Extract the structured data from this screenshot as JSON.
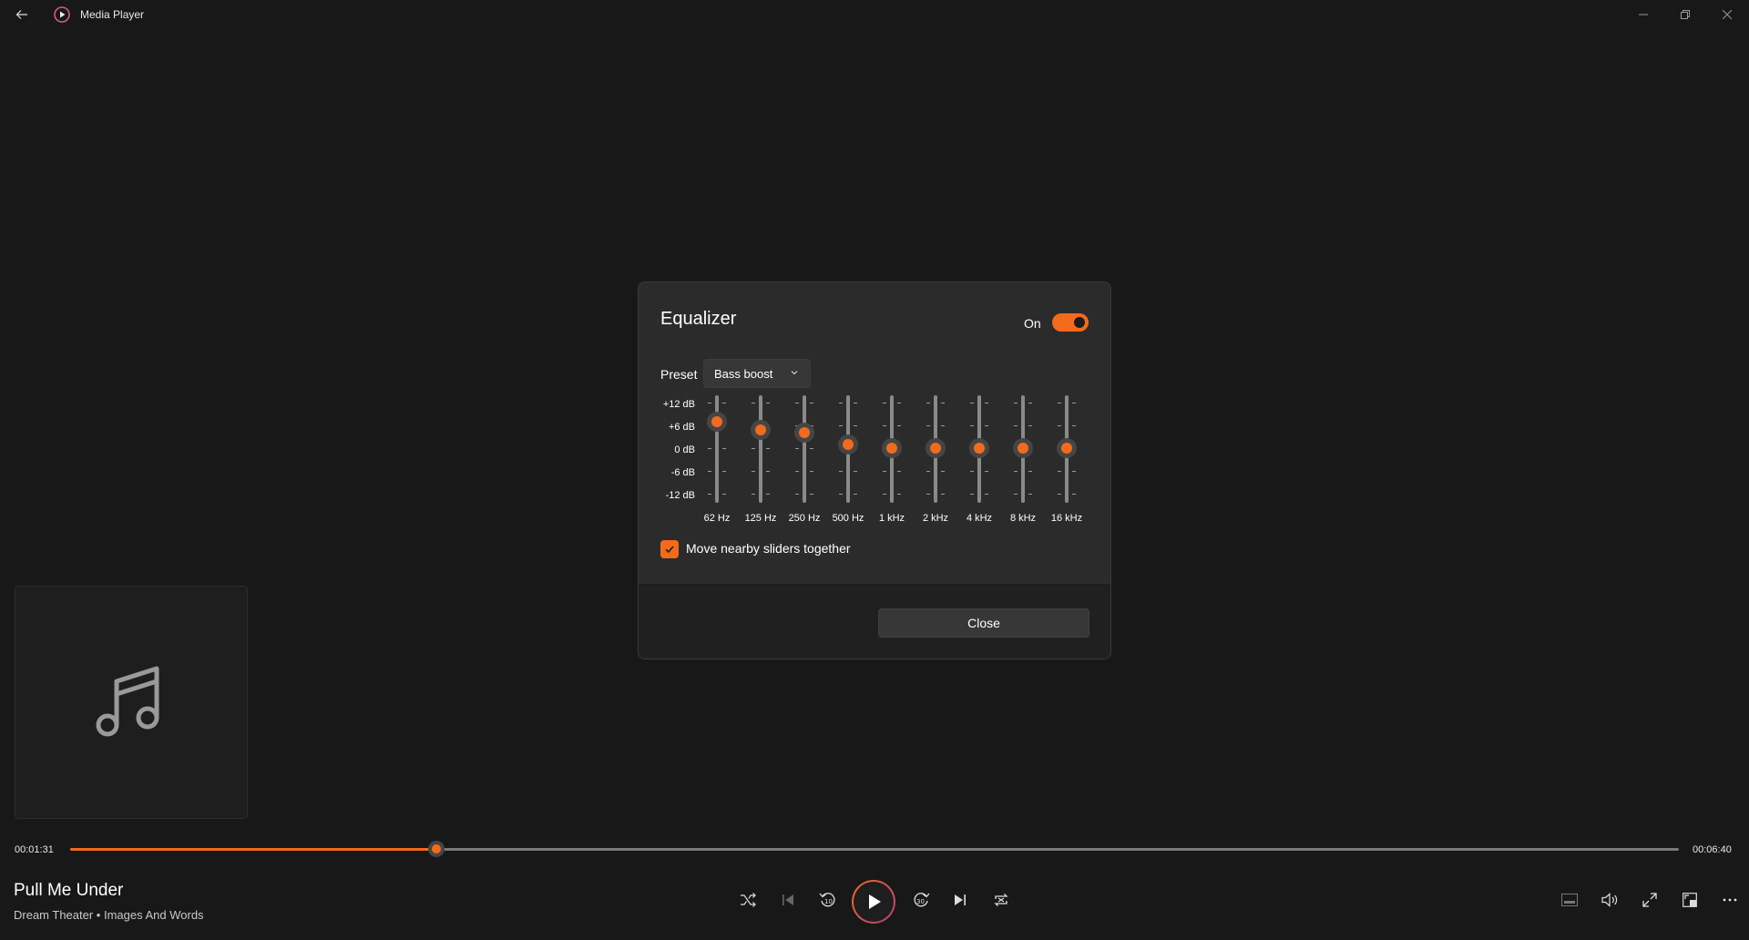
{
  "window": {
    "title": "Media Player",
    "icons": {
      "back": "back-arrow-icon",
      "app": "media-player-icon",
      "minimize": "minimize-icon",
      "maximize": "restore-icon",
      "close": "close-icon"
    }
  },
  "equalizer": {
    "title": "Equalizer",
    "toggle_label": "On",
    "toggle_on": true,
    "preset_label": "Preset",
    "preset_value": "Bass boost",
    "db_labels": [
      "+12 dB",
      "+6 dB",
      "0 dB",
      "-6 dB",
      "-12 dB"
    ],
    "bands": [
      {
        "label": "62 Hz",
        "gain_db": 7.0
      },
      {
        "label": "125 Hz",
        "gain_db": 4.8
      },
      {
        "label": "250 Hz",
        "gain_db": 4.2
      },
      {
        "label": "500 Hz",
        "gain_db": 1.0
      },
      {
        "label": "1 kHz",
        "gain_db": 0
      },
      {
        "label": "2 kHz",
        "gain_db": 0
      },
      {
        "label": "4 kHz",
        "gain_db": 0
      },
      {
        "label": "8 kHz",
        "gain_db": 0
      },
      {
        "label": "16 kHz",
        "gain_db": 0
      }
    ],
    "move_together_label": "Move nearby sliders together",
    "move_together_checked": true,
    "close_label": "Close"
  },
  "player": {
    "elapsed": "00:01:31",
    "total": "00:06:40",
    "progress_fraction": 0.2275,
    "song_title": "Pull Me Under",
    "song_subtitle": "Dream Theater • Images And Words",
    "accent_color": "#f26b1d",
    "controls": [
      "shuffle-icon",
      "previous-icon",
      "rewind-10-icon",
      "play-icon",
      "forward-30-icon",
      "next-icon",
      "repeat-icon"
    ],
    "right_controls": [
      "miniplayer-icon",
      "volume-icon",
      "fullscreen-icon",
      "cast-icon",
      "more-icon"
    ],
    "rewind_seconds": "10",
    "forward_seconds": "30"
  }
}
